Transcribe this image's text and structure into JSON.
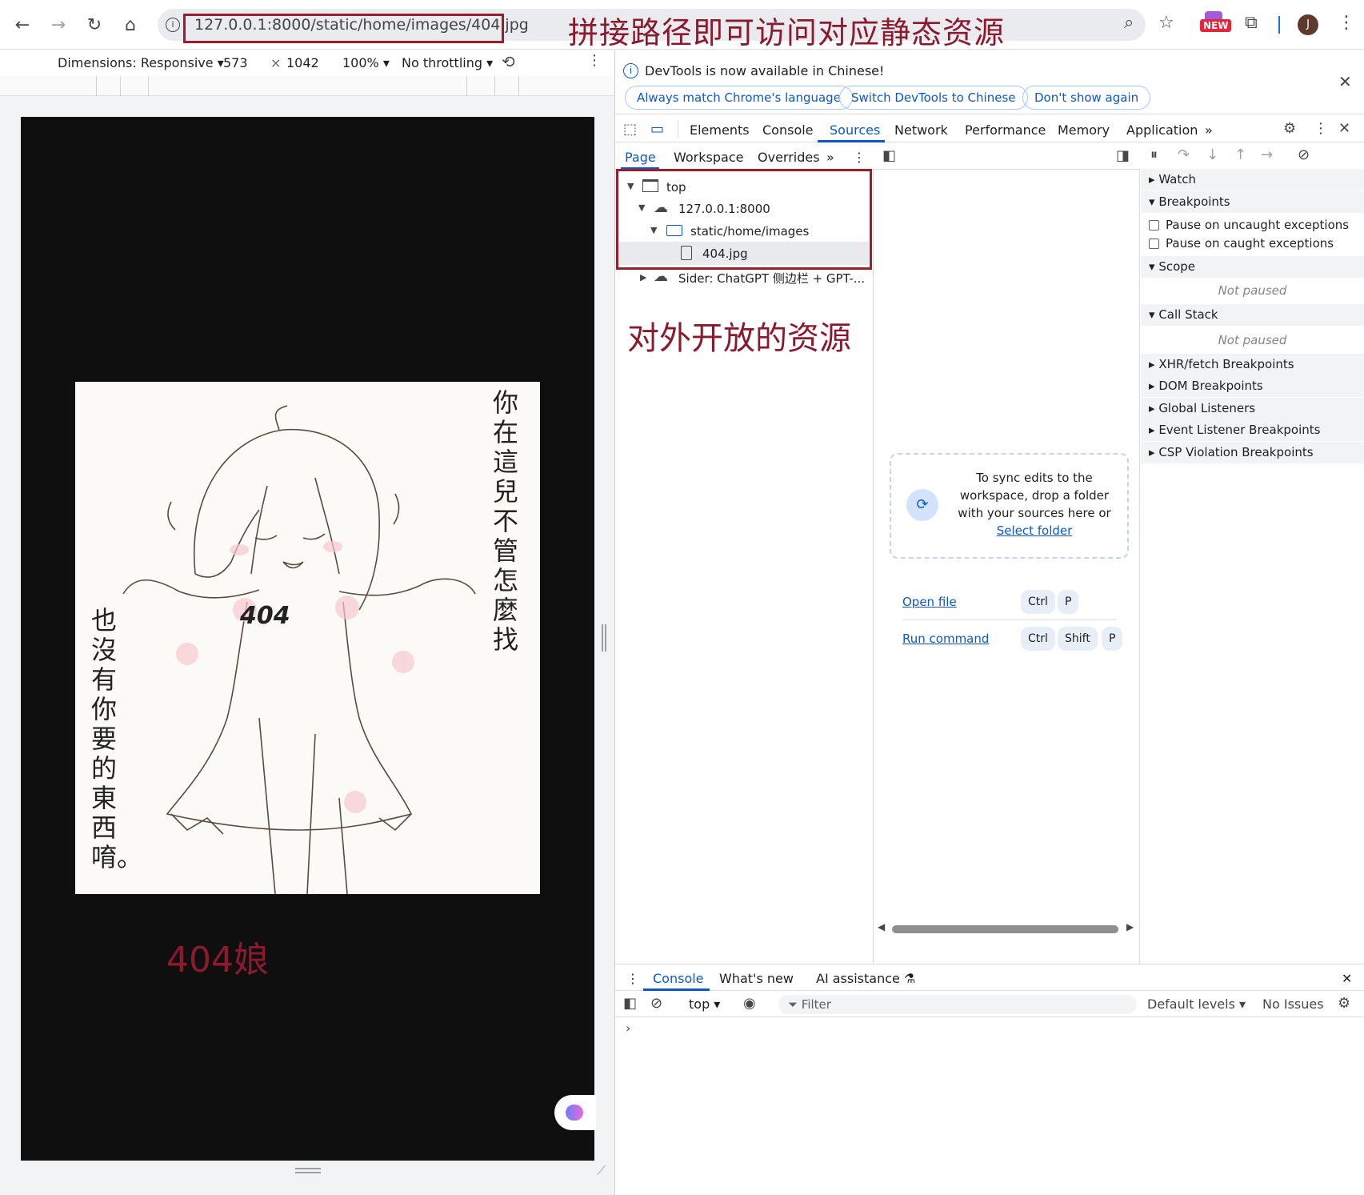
{
  "browser": {
    "url": "127.0.0.1:8000/static/home/images/404.jpg",
    "annotation_top": "拼接路径即可访问对应静态资源",
    "new_badge": "NEW",
    "avatar_letter": "J"
  },
  "device_toolbar": {
    "dimensions_label": "Dimensions: Responsive",
    "width": "573",
    "times": "×",
    "height": "1042",
    "zoom": "100%",
    "throttling": "No throttling"
  },
  "viewport": {
    "caption": "404娘",
    "image_text_right": "你在這兒不管怎麼找",
    "image_text_left": "也沒有你要的東西唷。",
    "image_shirt": "404"
  },
  "devtools": {
    "info": {
      "message": "DevTools is now available in Chinese!",
      "btn_match": "Always match Chrome's language",
      "btn_switch": "Switch DevTools to Chinese",
      "btn_dont": "Don't show again"
    },
    "tabs": [
      "Elements",
      "Console",
      "Sources",
      "Network",
      "Performance",
      "Memory",
      "Application"
    ],
    "subtabs": [
      "Page",
      "Workspace",
      "Overrides"
    ],
    "tree": {
      "top": "top",
      "origin": "127.0.0.1:8000",
      "folder": "static/home/images",
      "file": "404.jpg",
      "extension": "Sider: ChatGPT 侧边栏 + GPT-..."
    },
    "annotation_tree": "对外开放的资源",
    "editor": {
      "drop_text": "To sync edits to the workspace, drop a folder with your sources here or",
      "select_folder": "Select folder",
      "open_file": "Open file",
      "run_command": "Run command",
      "key_ctrl": "Ctrl",
      "key_p": "P",
      "key_shift": "Shift"
    },
    "debugger": {
      "watch": "Watch",
      "breakpoints": "Breakpoints",
      "pause_uncaught": "Pause on uncaught exceptions",
      "pause_caught": "Pause on caught exceptions",
      "scope": "Scope",
      "not_paused": "Not paused",
      "call_stack": "Call Stack",
      "xhr": "XHR/fetch Breakpoints",
      "dom": "DOM Breakpoints",
      "global": "Global Listeners",
      "event": "Event Listener Breakpoints",
      "csp": "CSP Violation Breakpoints"
    },
    "drawer": {
      "tab_console": "Console",
      "tab_whatsnew": "What's new",
      "tab_ai": "AI assistance",
      "context": "top",
      "filter": "Filter",
      "levels": "Default levels",
      "issues": "No Issues"
    }
  }
}
